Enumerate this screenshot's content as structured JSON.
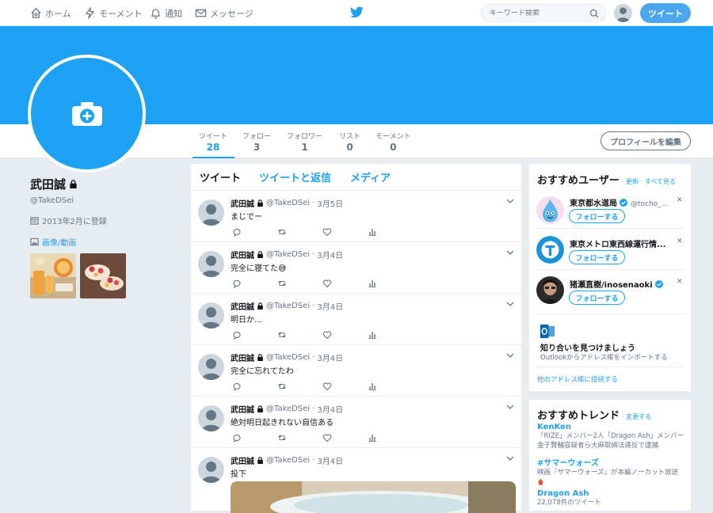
{
  "topnav": {
    "home": "ホーム",
    "moments": "モーメント",
    "notifications": "通知",
    "messages": "メッセージ",
    "search_placeholder": "キーワード検索",
    "tweet_button": "ツイート"
  },
  "profile": {
    "name": "武田誠",
    "handle": "@TakeDSei",
    "joined": "2013年2月に登録",
    "media_link": "画像/動画",
    "edit_button": "プロフィールを編集"
  },
  "stats": [
    {
      "label": "ツイート",
      "value": "28"
    },
    {
      "label": "フォロー",
      "value": "3"
    },
    {
      "label": "フォロワー",
      "value": "1"
    },
    {
      "label": "リスト",
      "value": "0"
    },
    {
      "label": "モーメント",
      "value": "0"
    }
  ],
  "timeline": {
    "tabs": [
      "ツイート",
      "ツイートと返信",
      "メディア"
    ],
    "tweets": [
      {
        "name": "武田誠",
        "handle": "@TakeDSei",
        "sep": "·",
        "date": "3月5日",
        "text": "まじでー"
      },
      {
        "name": "武田誠",
        "handle": "@TakeDSei",
        "sep": "·",
        "date": "3月4日",
        "text": "完全に寝てた😅"
      },
      {
        "name": "武田誠",
        "handle": "@TakeDSei",
        "sep": "·",
        "date": "3月4日",
        "text": "明日か…"
      },
      {
        "name": "武田誠",
        "handle": "@TakeDSei",
        "sep": "·",
        "date": "3月4日",
        "text": "完全に忘れてたわ"
      },
      {
        "name": "武田誠",
        "handle": "@TakeDSei",
        "sep": "·",
        "date": "3月4日",
        "text": "絶対明日起きれない自信ある"
      },
      {
        "name": "武田誠",
        "handle": "@TakeDSei",
        "sep": "·",
        "date": "3月4日",
        "text": "投下"
      }
    ]
  },
  "who_to_follow": {
    "title": "おすすめユーザー",
    "refresh": "· 更新",
    "view_all": "· すべて見る",
    "users": [
      {
        "name": "東京都水道局",
        "handle": "@tocho_...",
        "follow": "フォローする"
      },
      {
        "name": "東京メトロ東西線運行情...",
        "handle": "",
        "follow": "フォローする"
      },
      {
        "name": "猪瀬直樹/inosenaoki",
        "handle": "",
        "follow": "フォローする"
      }
    ],
    "find_friends_title": "知り合いを見つけましょう",
    "find_friends_desc": "Outlookからアドレス帳をインポートする",
    "connect_other": "他のアドレス帳に接続する"
  },
  "trends": {
    "title": "おすすめトレンド",
    "change": "· 変更する",
    "items": [
      {
        "name": "KenKen",
        "desc": "「RIZE」メンバー2人「Dragon Ash」メンバー 金子賢輔容疑者ら大麻取締法違反で逮捕"
      },
      {
        "name": "#サマーウォーズ",
        "desc": "映画『サマーウォーズ』が本編ノーカット放送"
      },
      {
        "name": "Dragon Ash",
        "desc": "22,078件のツイート"
      }
    ]
  },
  "colors": {
    "accent": "#1da1f2",
    "banner": "#1da1f2",
    "background": "#e6ecf0"
  }
}
